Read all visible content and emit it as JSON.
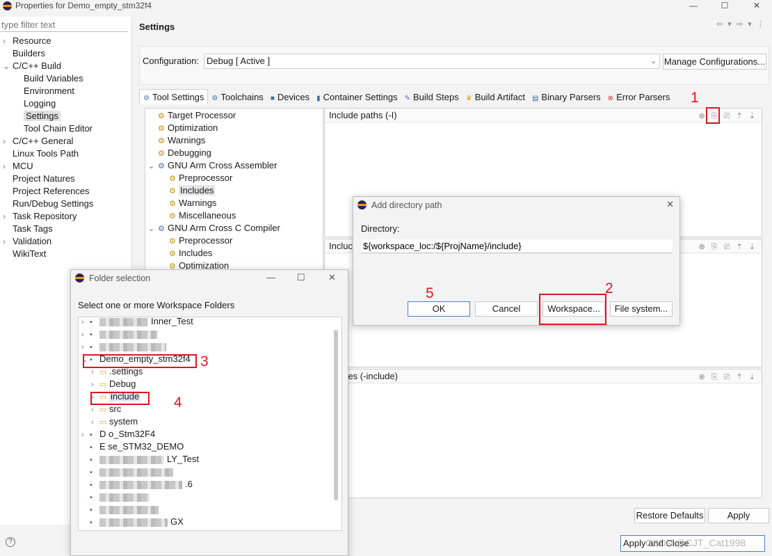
{
  "window": {
    "title": "Properties for Demo_empty_stm32f4",
    "minimize": "—",
    "maximize": "☐",
    "close": "✕"
  },
  "filter": {
    "placeholder": "type filter text"
  },
  "nav": [
    {
      "label": "Resource",
      "chev": "›",
      "indent": 0
    },
    {
      "label": "Builders",
      "chev": "",
      "indent": 0
    },
    {
      "label": "C/C++ Build",
      "chev": "⌄",
      "indent": 0
    },
    {
      "label": "Build Variables",
      "chev": "",
      "indent": 1
    },
    {
      "label": "Environment",
      "chev": "",
      "indent": 1
    },
    {
      "label": "Logging",
      "chev": "",
      "indent": 1
    },
    {
      "label": "Settings",
      "chev": "",
      "indent": 1,
      "selected": true
    },
    {
      "label": "Tool Chain Editor",
      "chev": "",
      "indent": 1
    },
    {
      "label": "C/C++ General",
      "chev": "›",
      "indent": 0
    },
    {
      "label": "Linux Tools Path",
      "chev": "",
      "indent": 0
    },
    {
      "label": "MCU",
      "chev": "›",
      "indent": 0
    },
    {
      "label": "Project Natures",
      "chev": "",
      "indent": 0
    },
    {
      "label": "Project References",
      "chev": "",
      "indent": 0
    },
    {
      "label": "Run/Debug Settings",
      "chev": "",
      "indent": 0
    },
    {
      "label": "Task Repository",
      "chev": "›",
      "indent": 0
    },
    {
      "label": "Task Tags",
      "chev": "",
      "indent": 0
    },
    {
      "label": "Validation",
      "chev": "›",
      "indent": 0
    },
    {
      "label": "WikiText",
      "chev": "",
      "indent": 0
    }
  ],
  "settings": {
    "title": "Settings",
    "nav_arrows": "⇦ ▾ ⇨ ▾ ⋮",
    "config_label": "Configuration:",
    "config_value": "Debug  [ Active ]",
    "manage_button": "Manage Configurations..."
  },
  "tabs": [
    {
      "label": "Tool Settings",
      "active": true
    },
    {
      "label": "Toolchains"
    },
    {
      "label": "Devices"
    },
    {
      "label": "Container Settings"
    },
    {
      "label": "Build Steps"
    },
    {
      "label": "Build Artifact"
    },
    {
      "label": "Binary Parsers"
    },
    {
      "label": "Error Parsers"
    }
  ],
  "tool_tree": [
    {
      "label": "Target Processor",
      "level": 0
    },
    {
      "label": "Optimization",
      "level": 0
    },
    {
      "label": "Warnings",
      "level": 0
    },
    {
      "label": "Debugging",
      "level": 0
    },
    {
      "label": "GNU Arm Cross Assembler",
      "level": 0,
      "expanded": true
    },
    {
      "label": "Preprocessor",
      "level": 1
    },
    {
      "label": "Includes",
      "level": 1,
      "selected": true
    },
    {
      "label": "Warnings",
      "level": 1
    },
    {
      "label": "Miscellaneous",
      "level": 1
    },
    {
      "label": "GNU Arm Cross C Compiler",
      "level": 0,
      "expanded": true
    },
    {
      "label": "Preprocessor",
      "level": 1
    },
    {
      "label": "Includes",
      "level": 1
    },
    {
      "label": "Optimization",
      "level": 1
    }
  ],
  "panels": {
    "include_paths": "Include paths (-I)",
    "include_short": "Incluc",
    "include_files": "de files (-include)",
    "tools": "⊕ ⎘ ⎚ ⇡ ⇣"
  },
  "footer": {
    "restore": "Restore Defaults",
    "apply": "Apply",
    "help": "?",
    "apply_close": "Apply and Close",
    "watermark": "CSDN @CJT_Cat1998"
  },
  "add_dir_dialog": {
    "title": "Add directory path",
    "directory_label": "Directory:",
    "directory_value": "${workspace_loc:/${ProjName}/include}",
    "ok": "OK",
    "cancel": "Cancel",
    "workspace": "Workspace...",
    "file_system": "File system..."
  },
  "folder_dialog": {
    "title": "Folder selection",
    "prompt": "Select one or more Workspace Folders",
    "items": [
      {
        "label": "Inner_Test",
        "indent": 0,
        "icon": "project",
        "blurred": true,
        "chev": "›"
      },
      {
        "label": "",
        "indent": 0,
        "icon": "project",
        "blurred": true,
        "chev": "›"
      },
      {
        "label": "",
        "indent": 0,
        "icon": "project",
        "blurred": true,
        "chev": "›"
      },
      {
        "label": "Demo_empty_stm32f4",
        "indent": 0,
        "icon": "project",
        "chev": "⌄"
      },
      {
        "label": ".settings",
        "indent": 1,
        "icon": "folder",
        "chev": "›"
      },
      {
        "label": "Debug",
        "indent": 1,
        "icon": "folder",
        "chev": "›"
      },
      {
        "label": "include",
        "indent": 1,
        "icon": "folder",
        "chev": "›",
        "selected": true
      },
      {
        "label": "src",
        "indent": 1,
        "icon": "folder",
        "chev": "›"
      },
      {
        "label": "system",
        "indent": 1,
        "icon": "folder",
        "chev": "›"
      },
      {
        "label": "D  o_Stm32F4",
        "indent": 0,
        "icon": "project",
        "chev": "›"
      },
      {
        "label": "E   se_STM32_DEMO",
        "indent": 0,
        "icon": "project",
        "chev": ""
      },
      {
        "label": "LY_Test",
        "indent": 0,
        "icon": "project",
        "blurred": true,
        "chev": ""
      },
      {
        "label": "",
        "indent": 0,
        "icon": "project",
        "blurred": true,
        "chev": ""
      },
      {
        "label": ".6",
        "indent": 0,
        "icon": "project",
        "blurred": true,
        "chev": ""
      },
      {
        "label": "",
        "indent": 0,
        "icon": "project",
        "blurred": true,
        "chev": ""
      },
      {
        "label": "",
        "indent": 0,
        "icon": "project",
        "blurred": true,
        "chev": ""
      },
      {
        "label": "GX",
        "indent": 0,
        "icon": "project",
        "blurred": true,
        "chev": ""
      }
    ]
  },
  "annotations": [
    "1",
    "2",
    "3",
    "4",
    "5"
  ],
  "colors": {
    "annotation": "#e0141e",
    "selection": "#dde8f6",
    "accent": "#4a7bd0"
  }
}
